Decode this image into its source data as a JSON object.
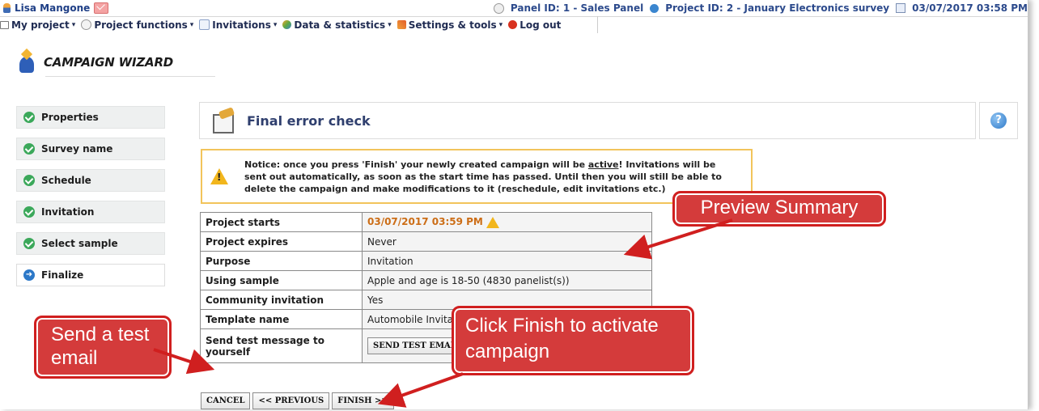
{
  "userbar": {
    "user_name": "Lisa Mangone",
    "panel": "Panel ID: 1 - Sales Panel",
    "project": "Project ID: 2 - January Electronics survey",
    "datetime": "03/07/2017 03:58 PM"
  },
  "menu": {
    "items": [
      {
        "label": "My project",
        "icon": "home-icon",
        "has_caret": true
      },
      {
        "label": "Project functions",
        "icon": "project-functions-icon",
        "has_caret": true
      },
      {
        "label": "Invitations",
        "icon": "envelope-icon",
        "has_caret": true
      },
      {
        "label": "Data & statistics",
        "icon": "data-statistics-icon",
        "has_caret": true
      },
      {
        "label": "Settings & tools",
        "icon": "tools-icon",
        "has_caret": true
      },
      {
        "label": "Log out",
        "icon": "logout-icon",
        "has_caret": false
      }
    ]
  },
  "wizard": {
    "title": "CAMPAIGN WIZARD"
  },
  "steps": [
    {
      "label": "Properties",
      "status": "done"
    },
    {
      "label": "Survey name",
      "status": "done"
    },
    {
      "label": "Schedule",
      "status": "done"
    },
    {
      "label": "Invitation",
      "status": "done"
    },
    {
      "label": "Select sample",
      "status": "done"
    },
    {
      "label": "Finalize",
      "status": "current"
    }
  ],
  "panel": {
    "title": "Final error check",
    "help_glyph": "?"
  },
  "notice": {
    "before": "Notice: once you press 'Finish' your newly created campaign will be ",
    "emphasis": "active",
    "after": "! Invitations will be sent out automatically, as soon as the start time has passed. Until then you will still be able to delete the campaign and make modifications to it (reschedule, edit invitations etc.)"
  },
  "summary": {
    "rows": [
      {
        "key": "Project starts",
        "value": "03/07/2017 03:59 PM"
      },
      {
        "key": "Project expires",
        "value": "Never"
      },
      {
        "key": "Purpose",
        "value": "Invitation"
      },
      {
        "key": "Using sample",
        "value": "Apple and age is 18-50 (4830 panelist(s))"
      },
      {
        "key": "Community invitation",
        "value": "Yes"
      },
      {
        "key": "Template name",
        "value": "Automobile Invitati"
      },
      {
        "key": "Send test message to yourself",
        "button": "SEND TEST EMAIL"
      }
    ]
  },
  "buttons": {
    "cancel": "CANCEL",
    "previous": "<< PREVIOUS",
    "finish": "FINISH >>"
  },
  "annotations": {
    "preview": "Preview Summary",
    "send": "Send a test email",
    "finish": "Click Finish to activate campaign"
  },
  "colors": {
    "accent": "#2f3f6e",
    "step_done": "#3ba85a",
    "step_current": "#2c78c8",
    "warning": "#f2b61c",
    "callout": "#d43b3b"
  }
}
